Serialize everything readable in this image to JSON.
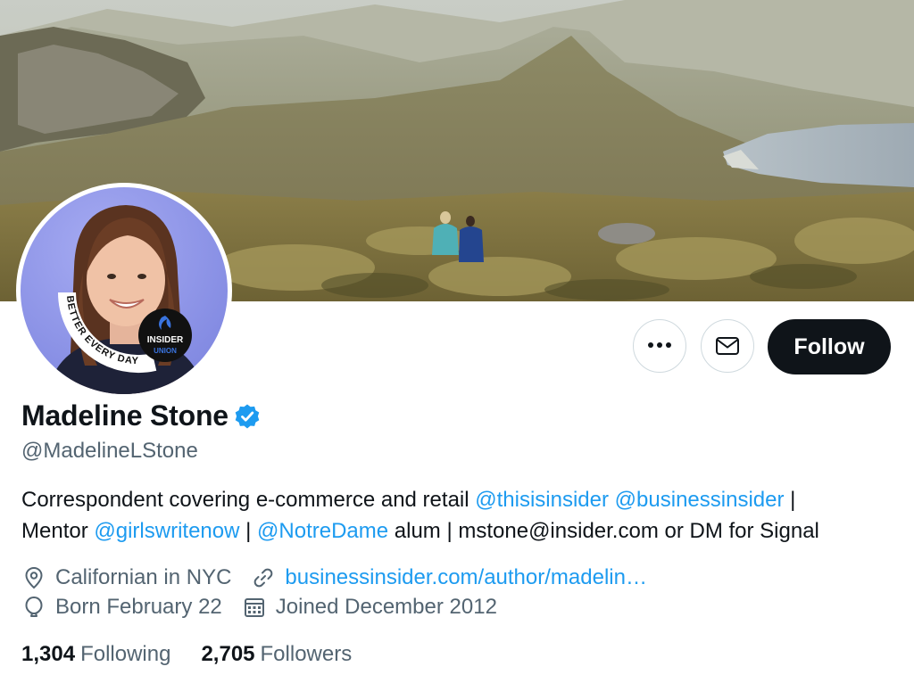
{
  "profile": {
    "display_name": "Madeline Stone",
    "handle": "@MadelineLStone",
    "verified": true,
    "bio": {
      "line1_text": "Correspondent covering e-commerce and retail ",
      "line1_mention1": "@thisisinsider",
      "line1_space": " ",
      "line1_mention2": "@businessinsider",
      "line1_end": " |",
      "line2_start": "Mentor ",
      "line2_mention1": "@girlswritenow",
      "line2_sep": " | ",
      "line2_mention2": "@NotreDame",
      "line2_end": " alum | mstone@insider.com or DM for Signal"
    },
    "location": "Californian in NYC",
    "website": "businessinsider.com/author/madelin…",
    "birthday": "Born February 22",
    "joined": "Joined December 2012",
    "following_count": "1,304",
    "following_label": "Following",
    "followers_count": "2,705",
    "followers_label": "Followers"
  },
  "avatar": {
    "badge_arc_text": "BETTER EVERY DAY",
    "badge_top": "INSIDER",
    "badge_bottom": "UNION"
  },
  "actions": {
    "more_label": "…",
    "follow_label": "Follow"
  },
  "icons": {
    "more": "more-dots-icon",
    "message": "envelope-icon",
    "verified": "verified-badge-icon",
    "location": "location-pin-icon",
    "website": "link-icon",
    "birthday": "balloon-icon",
    "joined": "calendar-icon"
  },
  "colors": {
    "accent": "#1d9bf0",
    "text_primary": "#0f1419",
    "text_secondary": "#536471",
    "follow_button_bg": "#0f1419",
    "border": "#cfd9de",
    "avatar_bg": "#8f96e6"
  }
}
